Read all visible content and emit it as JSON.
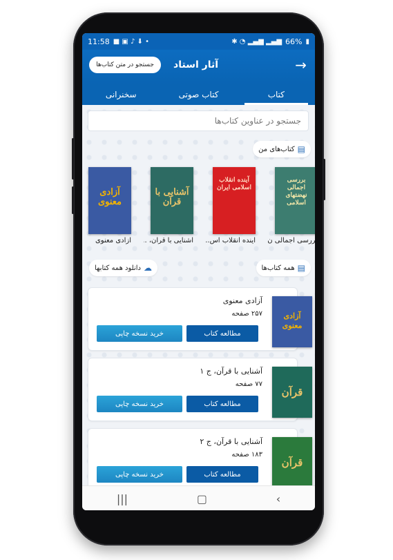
{
  "status": {
    "time": "11:58",
    "battery": "66%"
  },
  "appbar": {
    "title": "آثار استاد",
    "search_pill": "جستجو در متن کتاب‌ها"
  },
  "tabs": [
    {
      "label": "کتاب"
    },
    {
      "label": "کتاب صوتی"
    },
    {
      "label": "سخنرانی"
    }
  ],
  "search": {
    "placeholder": "جستجو در عناوین کتاب‌ها"
  },
  "my_books": {
    "header": "کتاب‌های من",
    "items": [
      {
        "label": "بررسی اجمالی ن...",
        "cover_title": "بررسی اجمالی نهضتهای اسلامی",
        "color": "#3d7d70"
      },
      {
        "label": "آینده انقلاب اس...",
        "cover_title": "آینده انقلاب اسلامی ایران",
        "color": "#d71f22"
      },
      {
        "label": "آشنایی با قرآن، ...",
        "cover_title": "آشنایی با قرآن",
        "color": "#2d6b63"
      },
      {
        "label": "آزادی معنوی",
        "cover_title": "آزادی معنوی",
        "color": "#3a5aa3"
      }
    ]
  },
  "all_books": {
    "header": "همه کتاب‌ها",
    "download_all": "دانلود همه کتابها",
    "items": [
      {
        "title": "آزادی معنوی",
        "pages": "۲۵۷ صفحه",
        "read": "مطالعه کتاب",
        "buy": "خرید نسخه چاپی",
        "color": "#3a5aa3",
        "cover_title": "آزادی معنوی"
      },
      {
        "title": "آشنایی با قرآن، ج ۱",
        "pages": "۷۷ صفحه",
        "read": "مطالعه کتاب",
        "buy": "خرید نسخه چاپی",
        "color": "#1f6a5a",
        "cover_title": "قرآن"
      },
      {
        "title": "آشنایی با قرآن، ج ۲",
        "pages": "۱۸۳ صفحه",
        "read": "مطالعه کتاب",
        "buy": "خرید نسخه چاپی",
        "color": "#2b7a3c",
        "cover_title": "قرآن"
      }
    ]
  }
}
